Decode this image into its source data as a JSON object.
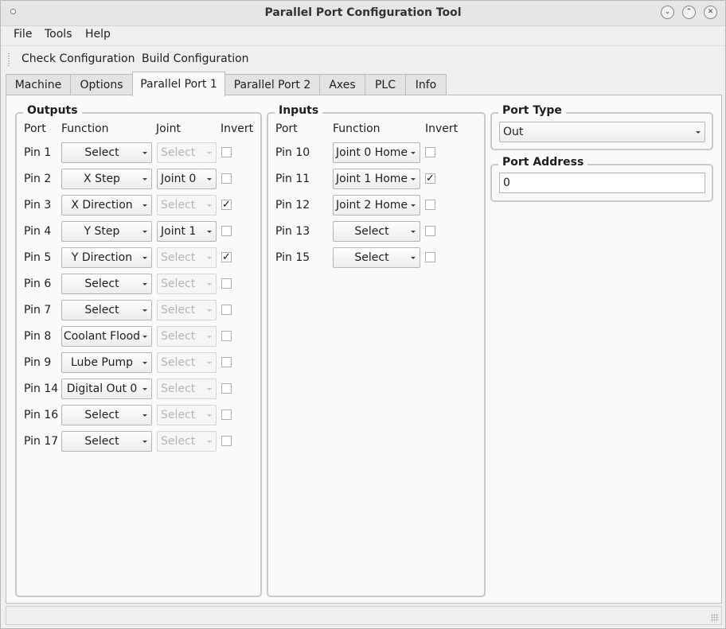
{
  "window": {
    "title": "Parallel Port Configuration Tool"
  },
  "menu": [
    "File",
    "Tools",
    "Help"
  ],
  "toolbar": [
    "Check Configuration",
    "Build Configuration"
  ],
  "tabs": [
    {
      "label": "Machine",
      "active": false
    },
    {
      "label": "Options",
      "active": false
    },
    {
      "label": "Parallel Port 1",
      "active": true
    },
    {
      "label": "Parallel Port 2",
      "active": false
    },
    {
      "label": "Axes",
      "active": false
    },
    {
      "label": "PLC",
      "active": false
    },
    {
      "label": "Info",
      "active": false
    }
  ],
  "outputs": {
    "title": "Outputs",
    "headers": {
      "port": "Port",
      "function": "Function",
      "joint": "Joint",
      "invert": "Invert"
    },
    "rows": [
      {
        "pin": "Pin 1",
        "function": "Select",
        "joint": "Select",
        "joint_enabled": false,
        "invert": false
      },
      {
        "pin": "Pin 2",
        "function": "X Step",
        "joint": "Joint 0",
        "joint_enabled": true,
        "invert": false
      },
      {
        "pin": "Pin 3",
        "function": "X Direction",
        "joint": "Select",
        "joint_enabled": false,
        "invert": true
      },
      {
        "pin": "Pin 4",
        "function": "Y Step",
        "joint": "Joint 1",
        "joint_enabled": true,
        "invert": false
      },
      {
        "pin": "Pin 5",
        "function": "Y Direction",
        "joint": "Select",
        "joint_enabled": false,
        "invert": true
      },
      {
        "pin": "Pin 6",
        "function": "Select",
        "joint": "Select",
        "joint_enabled": false,
        "invert": false
      },
      {
        "pin": "Pin 7",
        "function": "Select",
        "joint": "Select",
        "joint_enabled": false,
        "invert": false
      },
      {
        "pin": "Pin 8",
        "function": "Coolant Flood",
        "joint": "Select",
        "joint_enabled": false,
        "invert": false
      },
      {
        "pin": "Pin 9",
        "function": "Lube Pump",
        "joint": "Select",
        "joint_enabled": false,
        "invert": false
      },
      {
        "pin": "Pin 14",
        "function": "Digital Out 0",
        "joint": "Select",
        "joint_enabled": false,
        "invert": false
      },
      {
        "pin": "Pin 16",
        "function": "Select",
        "joint": "Select",
        "joint_enabled": false,
        "invert": false
      },
      {
        "pin": "Pin 17",
        "function": "Select",
        "joint": "Select",
        "joint_enabled": false,
        "invert": false
      }
    ]
  },
  "inputs": {
    "title": "Inputs",
    "headers": {
      "port": "Port",
      "function": "Function",
      "invert": "Invert"
    },
    "rows": [
      {
        "pin": "Pin 10",
        "function": "Joint 0 Home",
        "invert": false
      },
      {
        "pin": "Pin 11",
        "function": "Joint 1 Home",
        "invert": true
      },
      {
        "pin": "Pin 12",
        "function": "Joint 2 Home",
        "invert": false
      },
      {
        "pin": "Pin 13",
        "function": "Select",
        "invert": false
      },
      {
        "pin": "Pin 15",
        "function": "Select",
        "invert": false
      }
    ]
  },
  "port_type": {
    "title": "Port Type",
    "value": "Out"
  },
  "port_address": {
    "title": "Port Address",
    "value": "0"
  },
  "checkmark": "✓"
}
